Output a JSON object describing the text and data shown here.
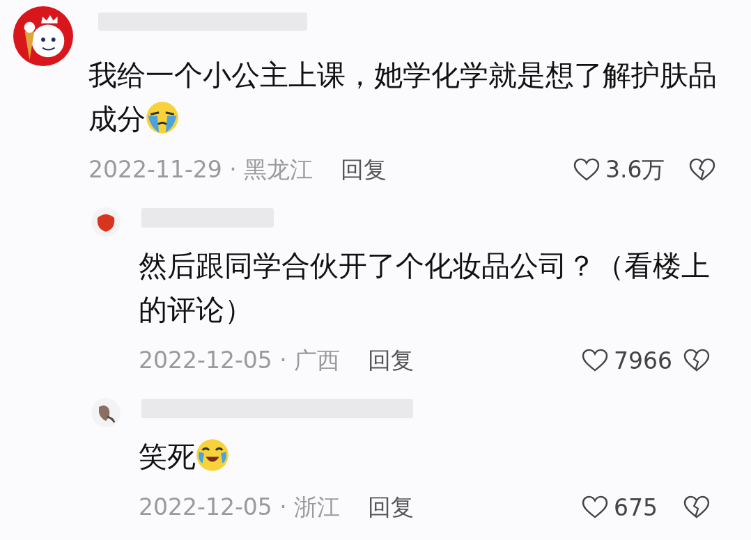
{
  "comment": {
    "text": "我给一个小公主上课，她学化学就是想了解护肤品成分",
    "emoji": {
      "kind": "crying"
    },
    "meta": "2022-11-29 · 黑龙江",
    "reply_label": "回复",
    "likes": "3.6万",
    "replies": [
      {
        "text": "然后跟同学合伙开了个化妆品公司？（看楼上的评论）",
        "meta": "2022-12-05 · 广西",
        "reply_label": "回复",
        "likes": "7966"
      },
      {
        "text": "笑死",
        "emoji": {
          "kind": "laughing"
        },
        "meta": "2022-12-05 · 浙江",
        "reply_label": "回复",
        "likes": "675"
      }
    ]
  }
}
